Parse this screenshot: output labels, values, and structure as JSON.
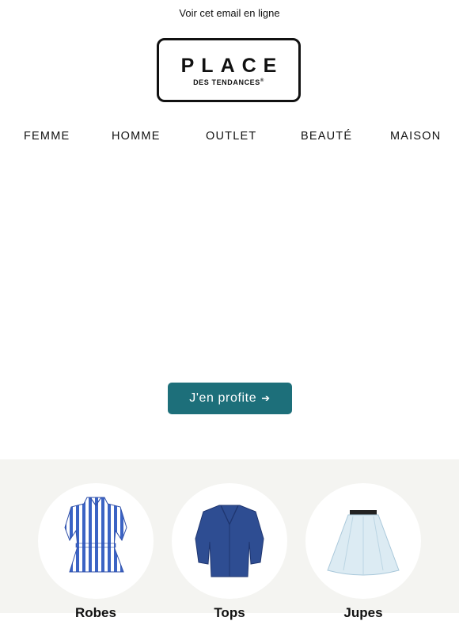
{
  "header": {
    "view_online": "Voir cet email en ligne",
    "logo_main": "PLACE",
    "logo_sub": "DES TENDANCES",
    "logo_reg": "®"
  },
  "nav": {
    "items": [
      "FEMME",
      "HOMME",
      "OUTLET",
      "BEAUTÉ",
      "MAISON"
    ]
  },
  "cta": {
    "label": "J'en profite",
    "arrow": "➔",
    "color": "#1d6f7a"
  },
  "categories": {
    "background": "#f4f4f1",
    "items": [
      {
        "label": "Robes",
        "image": "striped-dress-image"
      },
      {
        "label": "Tops",
        "image": "blue-blouse-image"
      },
      {
        "label": "Jupes",
        "image": "light-blue-skirt-image"
      }
    ]
  }
}
